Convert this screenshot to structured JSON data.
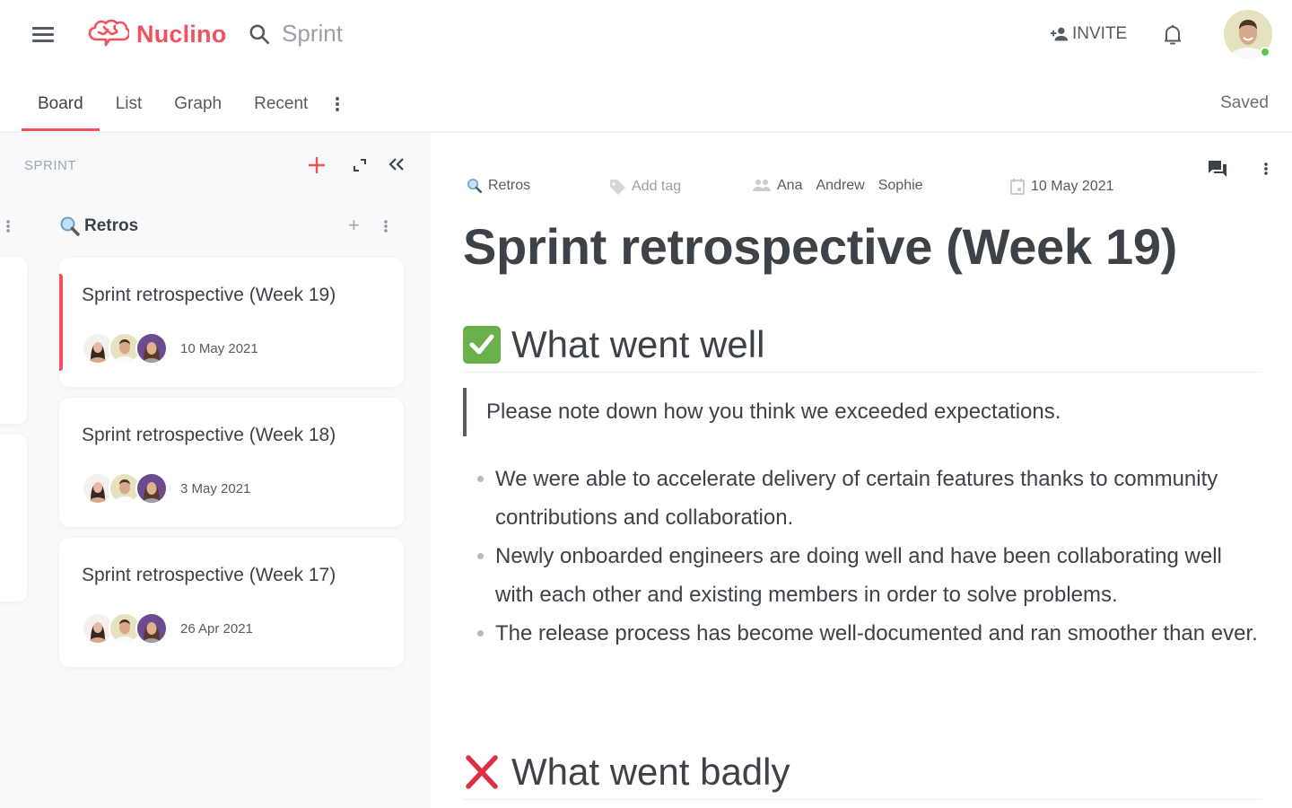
{
  "app": {
    "name": "Nuclino",
    "brand_color": "#f2525d",
    "search_text": "Sprint",
    "invite_label": "INVITE",
    "status": "Saved"
  },
  "tabs": [
    {
      "label": "Board",
      "active": true
    },
    {
      "label": "List",
      "active": false
    },
    {
      "label": "Graph",
      "active": false
    },
    {
      "label": "Recent",
      "active": false
    }
  ],
  "sidebar": {
    "title": "SPRINT",
    "column": {
      "icon": "magnifier-emoji",
      "title": "Retros",
      "cards": [
        {
          "title": "Sprint retrospective (Week 19)",
          "date": "10 May 2021",
          "selected": true,
          "members": [
            "Ana",
            "Andrew",
            "Sophie"
          ]
        },
        {
          "title": "Sprint retrospective (Week 18)",
          "date": "3 May 2021",
          "selected": false,
          "members": [
            "Ana",
            "Andrew",
            "Sophie"
          ]
        },
        {
          "title": "Sprint retrospective (Week 17)",
          "date": "26 Apr 2021",
          "selected": false,
          "members": [
            "Ana",
            "Andrew",
            "Sophie"
          ]
        }
      ]
    }
  },
  "document": {
    "collection": "Retros",
    "tag_placeholder": "Add tag",
    "members": [
      "Ana",
      "Andrew",
      "Sophie"
    ],
    "date": "10 May 2021",
    "title": "Sprint retrospective (Week 19)",
    "sections": [
      {
        "icon": "white-check-mark-emoji",
        "heading": "What went well",
        "quote": "Please note down how you think we exceeded expectations.",
        "bullets": [
          "We were able to accelerate delivery of certain features thanks to community contributions and collaboration.",
          "Newly onboarded engineers are doing well and have been collaborating well with each other and existing members in order to solve problems.",
          "The release process has become well-documented and ran smoother than ever."
        ]
      },
      {
        "icon": "cross-mark-emoji",
        "heading": "What went badly"
      }
    ]
  }
}
